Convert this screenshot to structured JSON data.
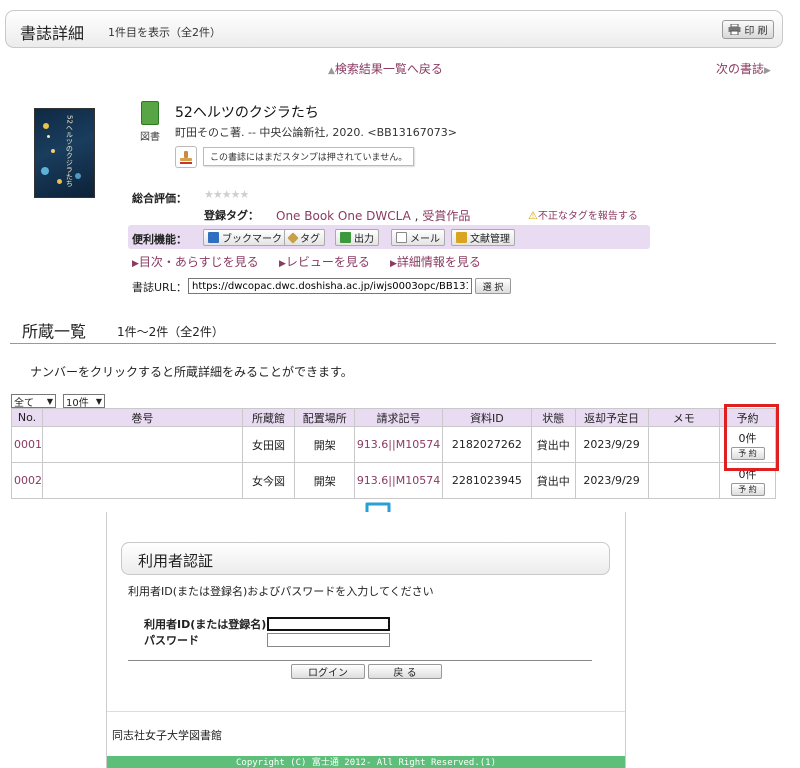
{
  "header": {
    "title": "書誌詳細",
    "count": "1件目を表示（全2件）",
    "print_label": "印 刷"
  },
  "nav": {
    "back_label": "検索結果一覧へ戻る",
    "next_label": "次の書誌"
  },
  "book": {
    "cover_title": "52ヘルツのクジラたち",
    "type": "図書",
    "title": "52ヘルツのクジラたち",
    "meta": "町田そのこ著. -- 中央公論新社, 2020. <BB13167073>",
    "stamp_message": "この書誌にはまだスタンプは押されていません。",
    "rating_label": "総合評価：",
    "stars": "★★★★★",
    "tag_label": "登録タグ：",
    "tags": [
      "One Book One DWCLA",
      "受賞作品"
    ],
    "tag_separator": ",",
    "report_tag": "不正なタグを報告する",
    "tools_label": "便利機能：",
    "tools": [
      {
        "label": "ブックマーク",
        "icon": "bookmark-icon",
        "color": "#2f6fbf"
      },
      {
        "label": "タグ",
        "icon": "tag-icon",
        "color": "#c9a04a"
      },
      {
        "label": "出力",
        "icon": "export-icon",
        "color": "#3c9a3c"
      },
      {
        "label": "メール",
        "icon": "mail-icon",
        "color": "#888888"
      },
      {
        "label": "文献管理",
        "icon": "folder-icon",
        "color": "#d9a520"
      }
    ],
    "links": [
      "目次・あらすじを見る",
      "レビューを見る",
      "詳細情報を見る"
    ],
    "url_label": "書誌URL：",
    "url_value": "https://dwcopac.dwc.doshisha.ac.jp/iwjs0003opc/BB13167073",
    "select_label": "選 択"
  },
  "holdings": {
    "title": "所蔵一覧",
    "count": "1件～2件（全2件）",
    "note": "ナンバーをクリックすると所蔵詳細をみることができます。",
    "filter_select": "全て",
    "per_page_select": "10件",
    "columns": [
      "No.",
      "巻号",
      "所蔵館",
      "配置場所",
      "請求記号",
      "資料ID",
      "状態",
      "返却予定日",
      "メモ",
      "予約"
    ],
    "rows": [
      {
        "no": "0001",
        "volume": "",
        "library": "女田図",
        "location": "開架",
        "call_number": "913.6||M10574",
        "item_id": "2182027262",
        "status": "貸出中",
        "due": "2023/9/29",
        "memo": "",
        "reservations": "0件",
        "reserve_label": "予 約"
      },
      {
        "no": "0002",
        "volume": "",
        "library": "女今図",
        "location": "開架",
        "call_number": "913.6||M10574",
        "item_id": "2281023945",
        "status": "貸出中",
        "due": "2023/9/29",
        "memo": "",
        "reservations": "0件",
        "reserve_label": "予 約"
      }
    ]
  },
  "login": {
    "title": "利用者認証",
    "note": "利用者ID(または登録名)およびパスワードを入力してください",
    "id_label": "利用者ID(または登録名)",
    "password_label": "パスワード",
    "id_value": "",
    "password_value": "",
    "login_label": "ログイン",
    "back_label": "戻 る",
    "library_name": "同志社女子大学図書館",
    "copyright": "Copyright (C) 富士通 2012- All Right Reserved.(1)"
  },
  "colors": {
    "link": "#8b3a62",
    "accent_purple": "#e8dbf2",
    "highlight": "#e02020",
    "arrow": "#2a9fd6",
    "footer": "#5dbf7a"
  }
}
